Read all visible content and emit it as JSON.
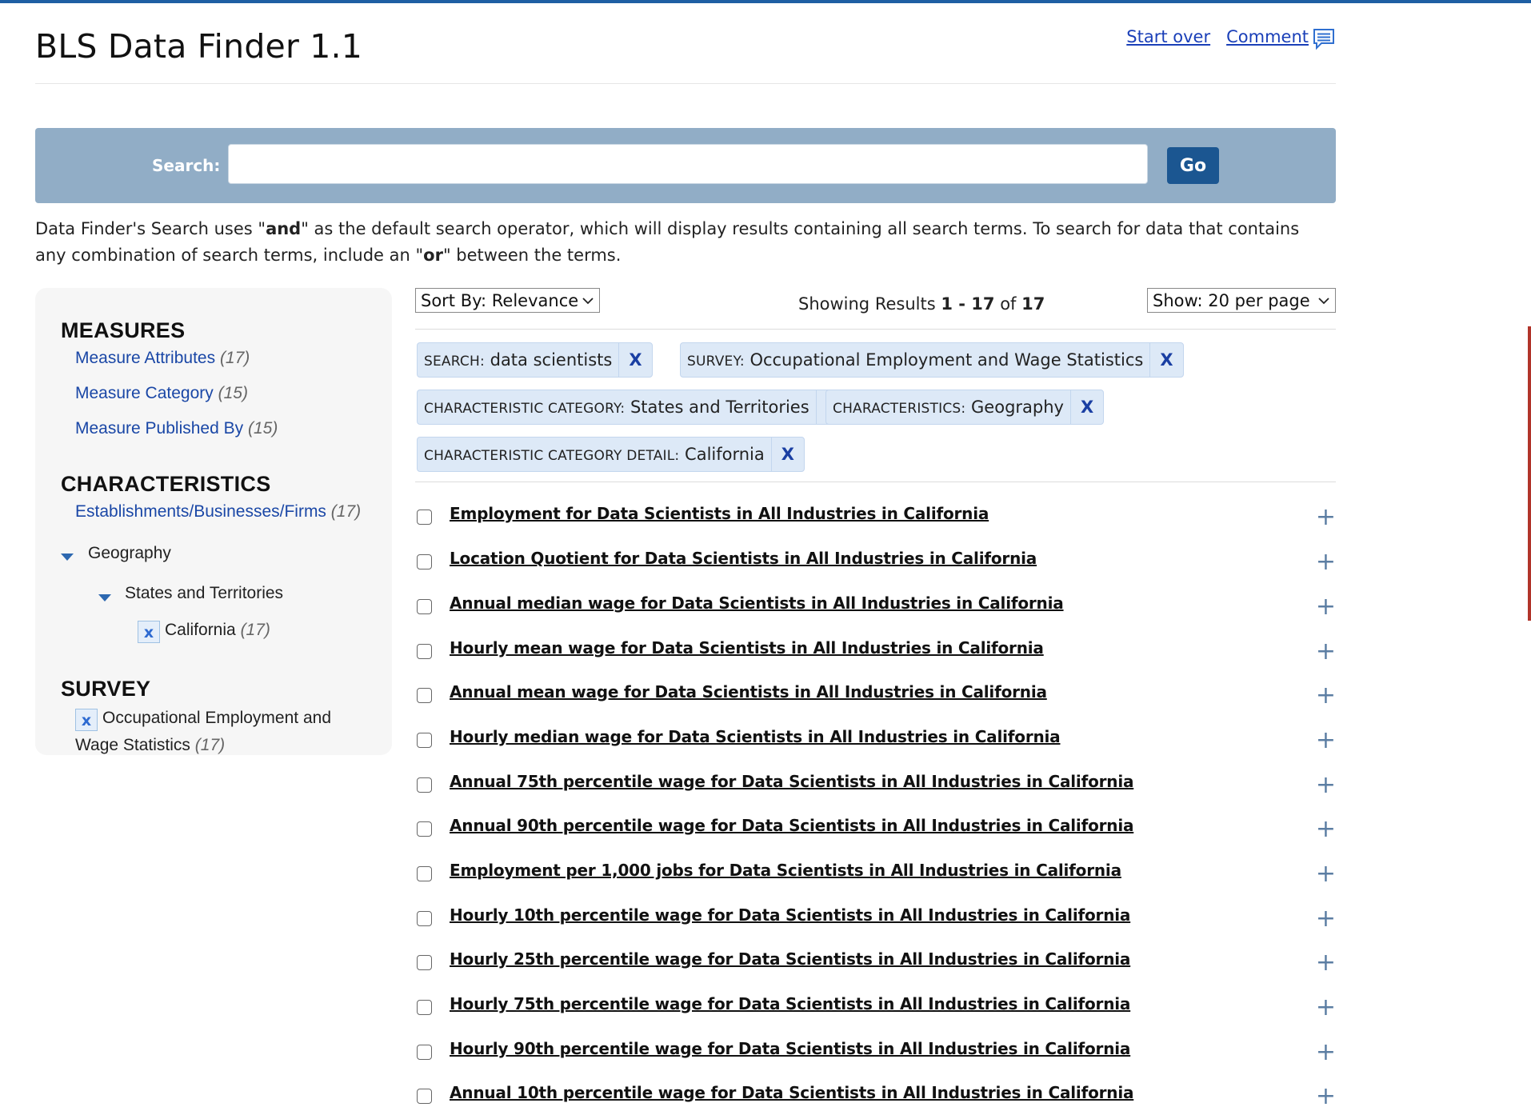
{
  "header": {
    "title": "BLS Data Finder 1.1",
    "start_over": "Start over",
    "comment": "Comment"
  },
  "search": {
    "label": "Search:",
    "value": "",
    "placeholder": "",
    "go": "Go"
  },
  "help": {
    "part1": "Data Finder's Search uses \"",
    "and_word": "and",
    "part2": "\" as the default search operator, which will display results containing all search terms. To search for data that contains any combination of search terms, include an \"",
    "or_word": "or",
    "part3": "\" between the terms."
  },
  "sidebar": {
    "measures_heading": "MEASURES",
    "measures": [
      {
        "label": "Measure Attributes",
        "count": "(17)"
      },
      {
        "label": "Measure Category",
        "count": "(15)"
      },
      {
        "label": "Measure Published By",
        "count": "(15)"
      }
    ],
    "characteristics_heading": "CHARACTERISTICS",
    "establishments": {
      "label": "Establishments/Businesses/Firms",
      "count": "(17)"
    },
    "geography": "Geography",
    "states": "States and Territories",
    "california": {
      "x": "x",
      "label": "California",
      "count": "(17)"
    },
    "survey_heading": "SURVEY",
    "survey": {
      "x": "x",
      "line1": "Occupational Employment and",
      "line2": "Wage Statistics",
      "count": "(17)"
    }
  },
  "results_bar": {
    "sort": "Sort By: Relevance",
    "showing_prefix": "Showing Results ",
    "range": "1 - 17",
    "of": " of ",
    "total": "17",
    "per_page": "Show: 20 per page"
  },
  "filters": [
    {
      "key": "SEARCH:",
      "value": "data scientists",
      "x": "X"
    },
    {
      "key": "SURVEY:",
      "value": "Occupational Employment and Wage Statistics",
      "x": "X"
    },
    {
      "key": "CHARACTERISTIC CATEGORY:",
      "value": "States and Territories",
      "x": "X"
    },
    {
      "key": "CHARACTERISTICS:",
      "value": "Geography",
      "x": "X"
    },
    {
      "key": "CHARACTERISTIC CATEGORY DETAIL:",
      "value": "California",
      "x": "X"
    }
  ],
  "results": [
    "Employment for Data Scientists in All Industries in California",
    "Location Quotient for Data Scientists in All Industries in California",
    "Annual median wage for Data Scientists in All Industries in California",
    "Hourly mean wage for Data Scientists in All Industries in California",
    "Annual mean wage for Data Scientists in All Industries in California",
    "Hourly median wage for Data Scientists in All Industries in California",
    "Annual 75th percentile wage for Data Scientists in All Industries in California",
    "Annual 90th percentile wage for Data Scientists in All Industries in California",
    "Employment per 1,000 jobs for Data Scientists in All Industries in California",
    "Hourly 10th percentile wage for Data Scientists in All Industries in California",
    "Hourly 25th percentile wage for Data Scientists in All Industries in California",
    "Hourly 75th percentile wage for Data Scientists in All Industries in California",
    "Hourly 90th percentile wage for Data Scientists in All Industries in California",
    "Annual 10th percentile wage for Data Scientists in All Industries in California"
  ],
  "expand_symbol": "+"
}
